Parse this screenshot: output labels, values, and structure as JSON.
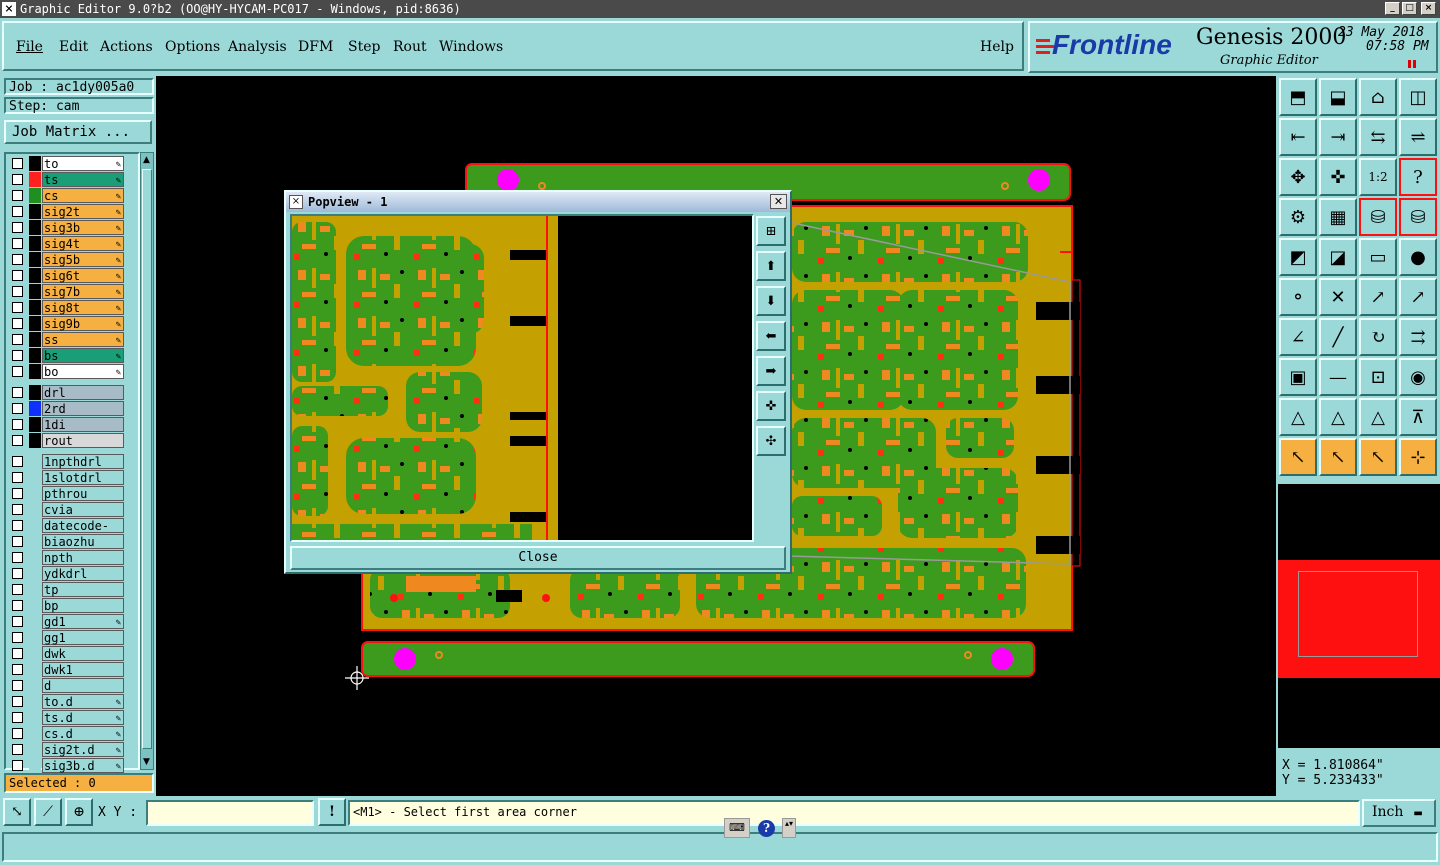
{
  "window": {
    "title": "Graphic Editor 9.0?b2 (OO@HY-HYCAM-PC017 - Windows, pid:8636)"
  },
  "menu": {
    "items": [
      "File",
      "Edit",
      "Actions",
      "Options",
      "Analysis",
      "DFM",
      "Step",
      "Rout",
      "Windows"
    ],
    "help": "Help"
  },
  "brand": {
    "logo": "Frontline",
    "product": "Genesis 2000",
    "subtitle": "Graphic Editor",
    "date": "23 May 2018",
    "time": "07:58 PM"
  },
  "job": {
    "job_label": "Job : ac1dy005a0",
    "step_label": "Step: cam",
    "matrix_button": "Job Matrix ..."
  },
  "layers": [
    {
      "name": "to",
      "bg": "#ffffff",
      "swatch": "#000000"
    },
    {
      "name": "ts",
      "bg": "#1a9e78",
      "swatch": "#ff2020"
    },
    {
      "name": "cs",
      "bg": "#f5b041",
      "swatch": "#1f8f1f"
    },
    {
      "name": "sig2t",
      "bg": "#f5b041",
      "swatch": "#000000"
    },
    {
      "name": "sig3b",
      "bg": "#f5b041",
      "swatch": "#000000"
    },
    {
      "name": "sig4t",
      "bg": "#f5b041",
      "swatch": "#000000"
    },
    {
      "name": "sig5b",
      "bg": "#f5b041",
      "swatch": "#000000"
    },
    {
      "name": "sig6t",
      "bg": "#f5b041",
      "swatch": "#000000"
    },
    {
      "name": "sig7b",
      "bg": "#f5b041",
      "swatch": "#000000"
    },
    {
      "name": "sig8t",
      "bg": "#f5b041",
      "swatch": "#000000"
    },
    {
      "name": "sig9b",
      "bg": "#f5b041",
      "swatch": "#000000"
    },
    {
      "name": "ss",
      "bg": "#f5b041",
      "swatch": "#000000"
    },
    {
      "name": "bs",
      "bg": "#1a9e78",
      "swatch": "#000000"
    },
    {
      "name": "bo",
      "bg": "#ffffff",
      "swatch": "#000000"
    }
  ],
  "drill_layers": [
    {
      "name": "drl",
      "bg": "#a8bcc8",
      "swatch": "#000000"
    },
    {
      "name": "2rd",
      "bg": "#a8bcc8",
      "swatch": "#1030ff"
    },
    {
      "name": "1di",
      "bg": "#a8bcc8",
      "swatch": "#000000"
    },
    {
      "name": "rout",
      "bg": "#d8d8d8",
      "swatch": "#000000"
    }
  ],
  "misc_layers": [
    "1npthdrl",
    "1slotdrl",
    "pthrou",
    "cvia",
    "datecode-to",
    "biaozhu",
    "npth",
    "ydkdrl",
    "tp",
    "bp",
    "gd1",
    "gg1",
    "dwk",
    "dwk1",
    "d",
    "to.d",
    "ts.d",
    "cs.d",
    "sig2t.d",
    "sig3b.d"
  ],
  "selected": "Selected : 0",
  "popview": {
    "title": "Popview - 1",
    "close_label": "Close"
  },
  "coords": {
    "x": "X = 1.810864\"",
    "y": "Y = 5.233433\""
  },
  "status": {
    "xy_label": "X Y :",
    "xy_value": "",
    "message": "<M1> - Select first area corner",
    "unit": "Inch"
  },
  "colors": {
    "panel": "#9bd9d9",
    "board_green": "#3c9a1c",
    "copper": "#c4a000",
    "pad_orange": "#f08820",
    "outline_red": "#ff1010",
    "fiducial": "#ff00ff"
  }
}
